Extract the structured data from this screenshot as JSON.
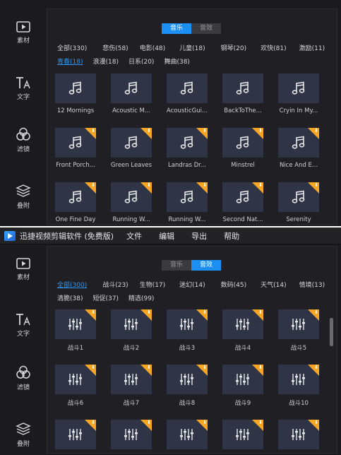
{
  "top_panel": {
    "sidebar": [
      {
        "label": "素材",
        "icon": "media-icon"
      },
      {
        "label": "文字",
        "icon": "text-icon"
      },
      {
        "label": "滤镜",
        "icon": "filter-icon"
      },
      {
        "label": "叠附",
        "icon": "overlay-icon"
      }
    ],
    "tabs": [
      {
        "label": "音乐",
        "active": true
      },
      {
        "label": "音效",
        "active": false
      }
    ],
    "categories_row1": [
      "全部(330)",
      "悲伤(58)",
      "电影(48)",
      "儿童(18)",
      "钢琴(20)",
      "欢快(81)",
      "激励(11)"
    ],
    "categories_row2": [
      "青春(18)",
      "浪漫(18)",
      "日系(20)",
      "舞曲(38)"
    ],
    "selected_category": "青春(18)",
    "tiles": [
      {
        "label": "12 Mornings",
        "download": false
      },
      {
        "label": "Acoustic M...",
        "download": false
      },
      {
        "label": "AcousticGui...",
        "download": false
      },
      {
        "label": "BackToThe...",
        "download": false
      },
      {
        "label": "Cryin In My...",
        "download": false
      },
      {
        "label": "Front Porch...",
        "download": true
      },
      {
        "label": "Green Leaves",
        "download": true
      },
      {
        "label": "Landras Dr...",
        "download": true
      },
      {
        "label": "Minstrel",
        "download": true
      },
      {
        "label": "Nice And E...",
        "download": true
      },
      {
        "label": "One Fine Day",
        "download": true
      },
      {
        "label": "Running W...",
        "download": true
      },
      {
        "label": "Running W...",
        "download": true
      },
      {
        "label": "Second Nat...",
        "download": true
      },
      {
        "label": "Serenity",
        "download": true
      }
    ]
  },
  "bottom_panel": {
    "app_title": "迅捷视频剪辑软件 (免费版)",
    "menu": [
      "文件",
      "编辑",
      "导出",
      "帮助"
    ],
    "sidebar": [
      {
        "label": "素材",
        "icon": "media-icon"
      },
      {
        "label": "文字",
        "icon": "text-icon"
      },
      {
        "label": "滤镜",
        "icon": "filter-icon"
      },
      {
        "label": "叠附",
        "icon": "overlay-icon"
      }
    ],
    "tabs": [
      {
        "label": "音乐",
        "active": false
      },
      {
        "label": "音效",
        "active": true
      }
    ],
    "categories_row1": [
      "全部(300)",
      "战斗(23)",
      "生物(17)",
      "迷幻(14)",
      "数码(45)",
      "天气(14)",
      "情境(13)"
    ],
    "categories_row2": [
      "清脆(38)",
      "短促(37)",
      "精选(99)"
    ],
    "selected_category": "全部(300)",
    "tiles": [
      {
        "label": "战斗1",
        "download": true
      },
      {
        "label": "战斗2",
        "download": true
      },
      {
        "label": "战斗3",
        "download": true
      },
      {
        "label": "战斗4",
        "download": true
      },
      {
        "label": "战斗5",
        "download": true
      },
      {
        "label": "战斗6",
        "download": true
      },
      {
        "label": "战斗7",
        "download": true
      },
      {
        "label": "战斗8",
        "download": true
      },
      {
        "label": "战斗9",
        "download": true
      },
      {
        "label": "战斗10",
        "download": true
      },
      {
        "label": "",
        "download": true
      },
      {
        "label": "",
        "download": true
      },
      {
        "label": "",
        "download": true
      },
      {
        "label": "",
        "download": true
      },
      {
        "label": "",
        "download": true
      }
    ]
  },
  "colors": {
    "accent": "#1c8ff5",
    "download_badge": "#f6a623",
    "tile_bg": "#2f3446",
    "panel_bg": "#1b1b1d"
  }
}
